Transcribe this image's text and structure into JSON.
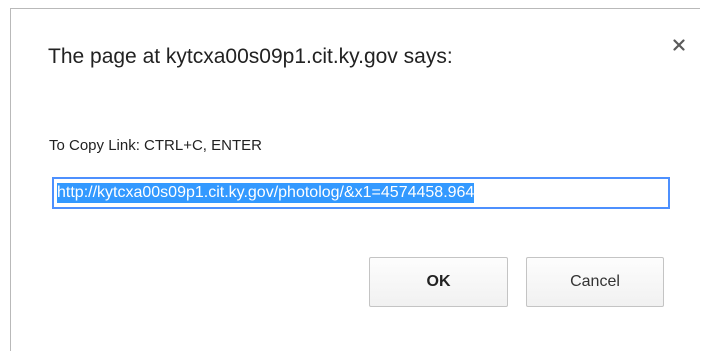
{
  "dialog": {
    "title": "The page at kytcxa00s09p1.cit.ky.gov says:",
    "close_icon": "close-icon",
    "prompt": "To Copy Link: CTRL+C, ENTER",
    "input_value": "http://kytcxa00s09p1.cit.ky.gov/photolog/&x1=4574458.964",
    "ok_label": "OK",
    "cancel_label": "Cancel"
  },
  "colors": {
    "selection": "#3399ff",
    "focus_border": "#4d90fe",
    "dialog_border": "#b9b9b9"
  }
}
